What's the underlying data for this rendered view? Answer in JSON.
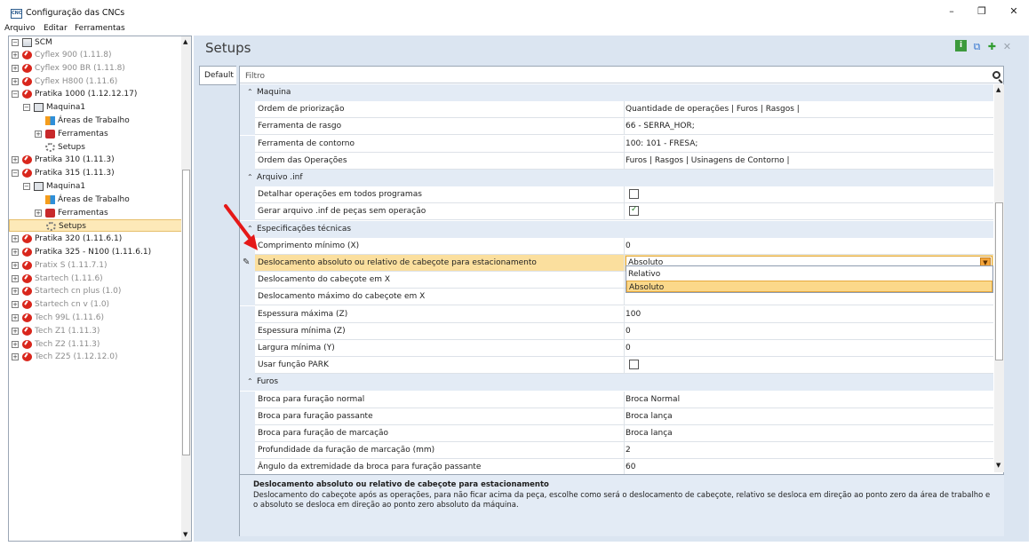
{
  "window": {
    "title": "Configuração das CNCs",
    "icon_text": "CNC",
    "minimize": "–",
    "maximize": "❐",
    "close": "✕"
  },
  "menu": [
    "Arquivo",
    "Editar",
    "Ferramentas"
  ],
  "tree": {
    "root": "SCM",
    "items": [
      {
        "label": "Cyflex 900 (1.11.8)",
        "level": 1,
        "expander": "⊞",
        "icon": "red",
        "gray": true
      },
      {
        "label": "Cyflex 900 BR (1.11.8)",
        "level": 1,
        "expander": "⊞",
        "icon": "red",
        "gray": true
      },
      {
        "label": "Cyflex H800 (1.11.6)",
        "level": 1,
        "expander": "⊞",
        "icon": "red",
        "gray": true
      },
      {
        "label": "Pratika 1000 (1.12.12.17)",
        "level": 1,
        "expander": "⊟",
        "icon": "red",
        "gray": false
      },
      {
        "label": "Maquina1",
        "level": 2,
        "expander": "⊟",
        "icon": "machine",
        "gray": false
      },
      {
        "label": "Áreas de Trabalho",
        "level": 3,
        "expander": "",
        "icon": "areas",
        "gray": false
      },
      {
        "label": "Ferramentas",
        "level": 3,
        "expander": "⊞",
        "icon": "tools",
        "gray": false
      },
      {
        "label": "Setups",
        "level": 3,
        "expander": "",
        "icon": "gear",
        "gray": false
      },
      {
        "label": "Pratika 310 (1.11.3)",
        "level": 1,
        "expander": "⊞",
        "icon": "red",
        "gray": false
      },
      {
        "label": "Pratika 315 (1.11.3)",
        "level": 1,
        "expander": "⊟",
        "icon": "red",
        "gray": false
      },
      {
        "label": "Maquina1",
        "level": 2,
        "expander": "⊟",
        "icon": "machine",
        "gray": false
      },
      {
        "label": "Áreas de Trabalho",
        "level": 3,
        "expander": "",
        "icon": "areas",
        "gray": false
      },
      {
        "label": "Ferramentas",
        "level": 3,
        "expander": "⊞",
        "icon": "tools",
        "gray": false
      },
      {
        "label": "Setups",
        "level": 3,
        "expander": "",
        "icon": "gear",
        "gray": false,
        "selected": true
      },
      {
        "label": "Pratika 320 (1.11.6.1)",
        "level": 1,
        "expander": "⊞",
        "icon": "red",
        "gray": false
      },
      {
        "label": "Pratika 325 - N100 (1.11.6.1)",
        "level": 1,
        "expander": "⊞",
        "icon": "red",
        "gray": false
      },
      {
        "label": "Pratix S (1.11.7.1)",
        "level": 1,
        "expander": "⊞",
        "icon": "red",
        "gray": true
      },
      {
        "label": "Startech (1.11.6)",
        "level": 1,
        "expander": "⊞",
        "icon": "red",
        "gray": true
      },
      {
        "label": "Startech cn plus (1.0)",
        "level": 1,
        "expander": "⊞",
        "icon": "red",
        "gray": true
      },
      {
        "label": "Startech cn v (1.0)",
        "level": 1,
        "expander": "⊞",
        "icon": "red",
        "gray": true
      },
      {
        "label": "Tech 99L (1.11.6)",
        "level": 1,
        "expander": "⊞",
        "icon": "red",
        "gray": true
      },
      {
        "label": "Tech Z1 (1.11.3)",
        "level": 1,
        "expander": "⊞",
        "icon": "red",
        "gray": true
      },
      {
        "label": "Tech Z2 (1.11.3)",
        "level": 1,
        "expander": "⊞",
        "icon": "red",
        "gray": true
      },
      {
        "label": "Tech Z25 (1.12.12.0)",
        "level": 1,
        "expander": "⊞",
        "icon": "red",
        "gray": true
      }
    ]
  },
  "main": {
    "title": "Setups",
    "tab": "Default",
    "filter_placeholder": "Filtro",
    "toolbar": {
      "info": "i",
      "copy": "⧉",
      "add": "✚",
      "delete": "✕"
    }
  },
  "grid": [
    {
      "type": "cat",
      "label": "Maquina"
    },
    {
      "type": "prop",
      "name": "Ordem de priorização",
      "value": "Quantidade de operações | Furos | Rasgos |"
    },
    {
      "type": "prop",
      "name": "Ferramenta de rasgo",
      "value": "66 - SERRA_HOR;"
    },
    {
      "type": "prop",
      "name": "Ferramenta de contorno",
      "value": "100: 101 - FRESA;"
    },
    {
      "type": "prop",
      "name": "Ordem das Operações",
      "value": "Furos | Rasgos | Usinagens de Contorno |"
    },
    {
      "type": "cat",
      "label": "Arquivo .inf"
    },
    {
      "type": "check",
      "name": "Detalhar operações em todos programas",
      "checked": false
    },
    {
      "type": "check",
      "name": "Gerar arquivo .inf de peças sem operação",
      "checked": true
    },
    {
      "type": "cat",
      "label": "Especificações técnicas"
    },
    {
      "type": "prop",
      "name": "Comprimento mínimo (X)",
      "value": "0"
    },
    {
      "type": "combo",
      "name": "Deslocamento absoluto ou relativo de cabeçote para estacionamento",
      "value": "Absoluto"
    },
    {
      "type": "prop",
      "name": "Deslocamento do cabeçote em X",
      "value": ""
    },
    {
      "type": "prop",
      "name": "Deslocamento máximo do cabeçote em X",
      "value": ""
    },
    {
      "type": "prop",
      "name": "Espessura máxima (Z)",
      "value": "100"
    },
    {
      "type": "prop",
      "name": "Espessura mínima (Z)",
      "value": "0"
    },
    {
      "type": "prop",
      "name": "Largura mínima (Y)",
      "value": "0"
    },
    {
      "type": "check",
      "name": "Usar função PARK",
      "checked": false
    },
    {
      "type": "cat",
      "label": "Furos"
    },
    {
      "type": "prop",
      "name": "Broca para furação normal",
      "value": "Broca Normal"
    },
    {
      "type": "prop",
      "name": "Broca para furação passante",
      "value": "Broca lança"
    },
    {
      "type": "prop",
      "name": "Broca para furação de marcação",
      "value": "Broca lança"
    },
    {
      "type": "prop",
      "name": "Profundidade da furação de marcação (mm)",
      "value": "2"
    },
    {
      "type": "prop",
      "name": "Ângulo da extremidade da broca para furação passante",
      "value": "60"
    }
  ],
  "dropdown": {
    "options": [
      "Relativo",
      "Absoluto"
    ],
    "selected": "Absoluto"
  },
  "description": {
    "title": "Deslocamento absoluto ou relativo de cabeçote para estacionamento",
    "text": "Deslocamento do cabeçote após as operações, para não ficar acima da peça, escolhe como será o deslocamento de cabeçote, relativo se desloca em direção ao ponto zero da área de trabalho e o absoluto se desloca em direção ao ponto zero absoluto da máquina."
  },
  "colors": {
    "accent_orange": "#f4a43a",
    "icon_red": "#d9261c",
    "selection": "#fde9b8"
  }
}
